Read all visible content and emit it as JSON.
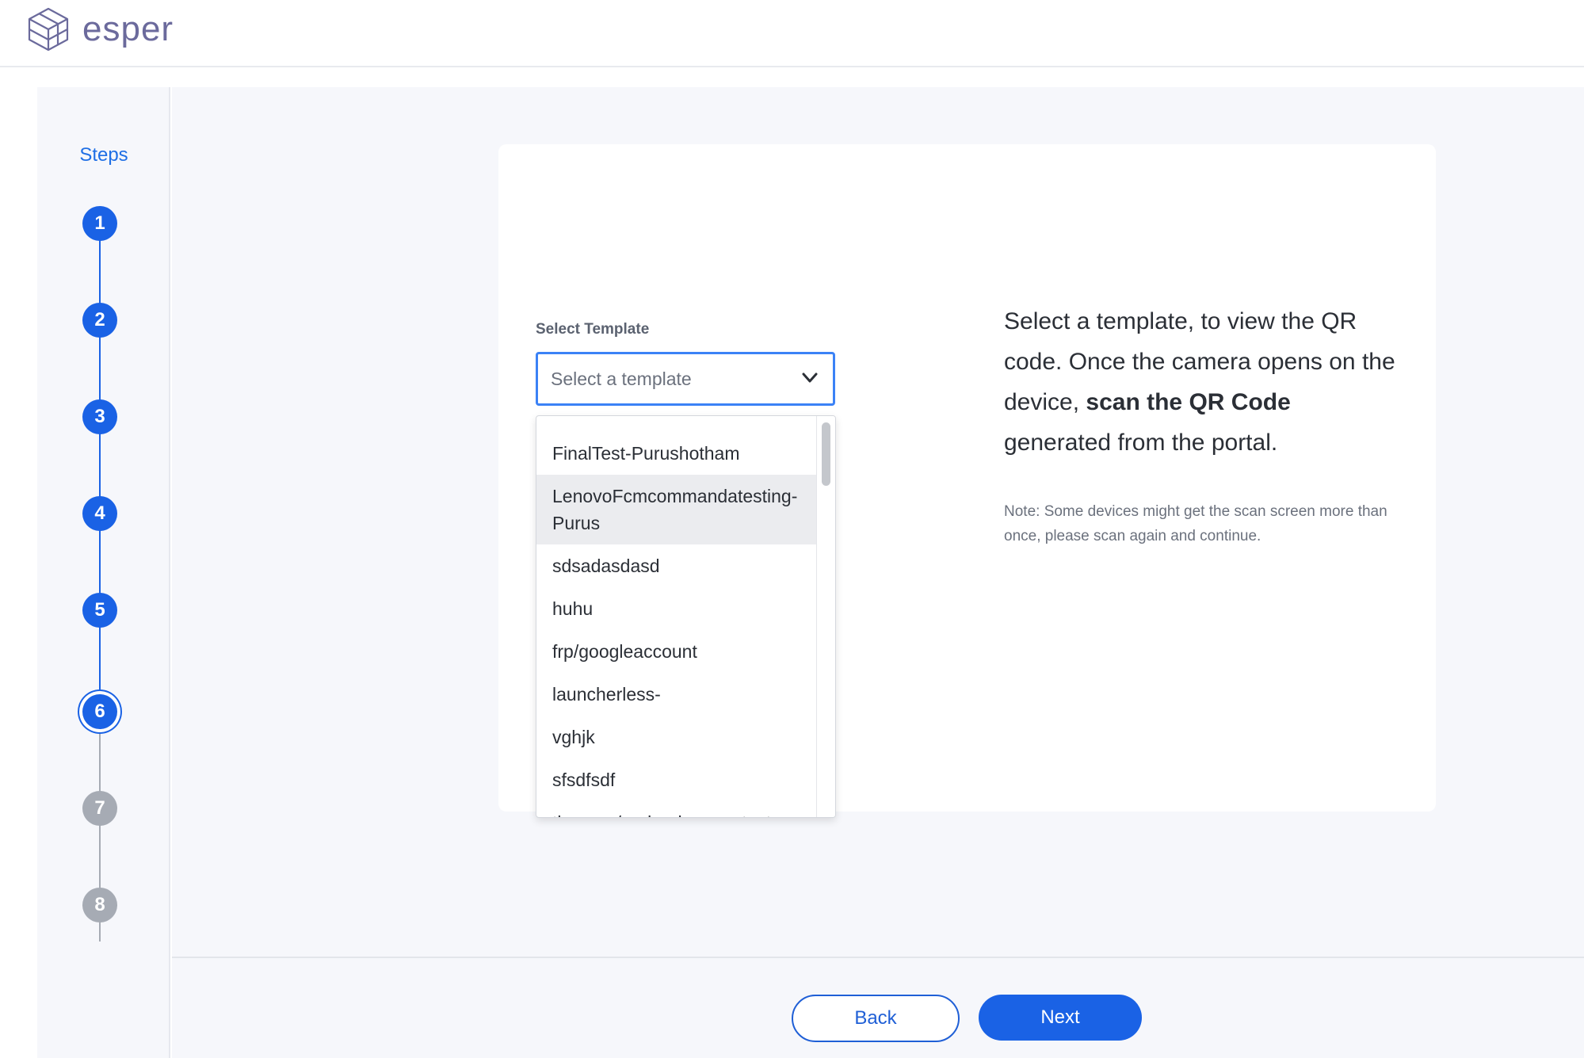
{
  "app": {
    "logo_text": "esper"
  },
  "sidebar": {
    "title": "Steps",
    "steps": [
      {
        "label": "1",
        "state": "done"
      },
      {
        "label": "2",
        "state": "done"
      },
      {
        "label": "3",
        "state": "done"
      },
      {
        "label": "4",
        "state": "done"
      },
      {
        "label": "5",
        "state": "done"
      },
      {
        "label": "6",
        "state": "current"
      },
      {
        "label": "7",
        "state": "todo"
      },
      {
        "label": "8",
        "state": "todo"
      }
    ]
  },
  "form": {
    "select_label": "Select Template",
    "select_placeholder": "Select a template",
    "options": [
      "FinalTest-Purushotham",
      "LenovoFcmcommandatesting-Purus",
      "sdsadasdasd",
      "huhu",
      "frp/googleaccount",
      "launcherless-",
      "vghjk",
      "sfsdfsdf",
      "timezon/preload_apps_test"
    ],
    "highlighted_option": "LenovoFcmcommandatesting-Purus"
  },
  "instructions": {
    "part1": "Select a template, to view the QR code. Once the camera opens on the device, ",
    "bold": "scan the QR Code",
    "part2": " generated from the portal.",
    "note": "Note: Some devices might get the scan screen more than once, please scan again and continue."
  },
  "footer": {
    "back_label": "Back",
    "next_label": "Next"
  },
  "colors": {
    "accent": "#1a62e5",
    "step_inactive": "#a6abb4",
    "background": "#f6f7fb"
  }
}
